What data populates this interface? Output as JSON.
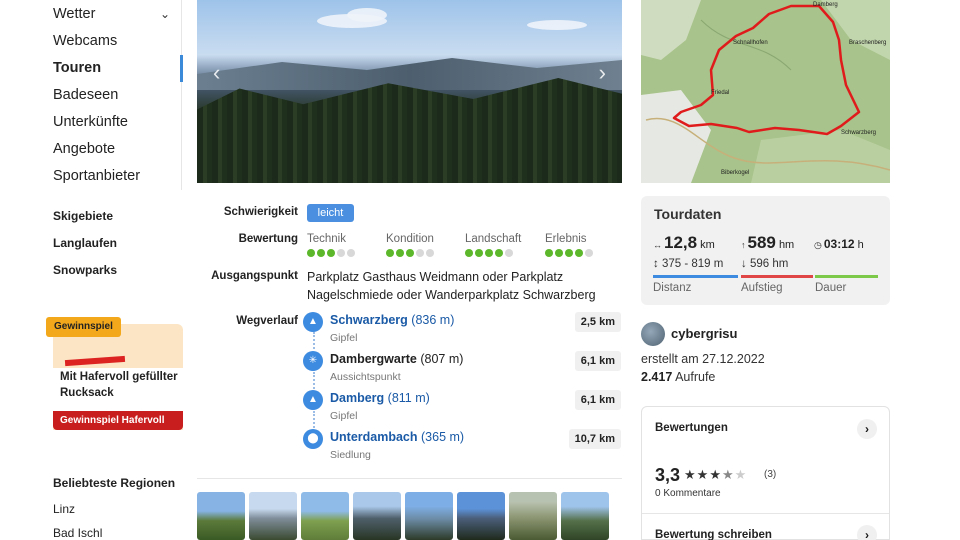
{
  "sidebar": {
    "main_items": [
      {
        "label": "Wetter"
      },
      {
        "label": "Webcams"
      },
      {
        "label": "Touren"
      },
      {
        "label": "Badeseen"
      },
      {
        "label": "Unterkünfte"
      },
      {
        "label": "Angebote"
      },
      {
        "label": "Sportanbieter"
      }
    ],
    "active_item": "Touren",
    "sub_items": [
      {
        "label": "Skigebiete"
      },
      {
        "label": "Langlaufen"
      },
      {
        "label": "Snowparks"
      }
    ],
    "promo": {
      "tag": "Gewinnspiel",
      "title": "Mit Hafervoll gefüllter Rucksack",
      "button": "Gewinnspiel Hafervoll"
    },
    "regions": {
      "heading": "Beliebteste Regionen",
      "links": [
        "Linz",
        "Bad Ischl"
      ]
    }
  },
  "details": {
    "difficulty_label": "Schwierigkeit",
    "difficulty_value": "leicht",
    "rating_label": "Bewertung",
    "ratings": [
      {
        "label": "Technik",
        "score": 3,
        "max": 5
      },
      {
        "label": "Kondition",
        "score": 3,
        "max": 5
      },
      {
        "label": "Landschaft",
        "score": 4,
        "max": 5
      },
      {
        "label": "Erlebnis",
        "score": 4,
        "max": 5
      }
    ],
    "start_label": "Ausgangspunkt",
    "start_value": "Parkplatz Gasthaus Weidmann oder Parkplatz Nagelschmiede oder Wanderparkplatz Schwarzberg",
    "route_label": "Wegverlauf",
    "stops": [
      {
        "name": "Schwarzberg",
        "elevation": "(836 m)",
        "type": "Gipfel",
        "km": "2,5 km",
        "icon": "peak-icon",
        "link": true
      },
      {
        "name": "Dambergwarte",
        "elevation": "(807 m)",
        "type": "Aussichtspunkt",
        "km": "6,1 km",
        "icon": "viewpoint-icon",
        "link": false
      },
      {
        "name": "Damberg",
        "elevation": "(811 m)",
        "type": "Gipfel",
        "km": "6,1 km",
        "icon": "peak-icon",
        "link": true
      },
      {
        "name": "Unterdambach",
        "elevation": "(365 m)",
        "type": "Siedlung",
        "km": "10,7 km",
        "icon": "location-pin-icon",
        "link": true
      }
    ]
  },
  "map": {
    "labels": [
      "Damberg",
      "Braschenberg",
      "Schwarzberg",
      "Biberkogel",
      "Schnallhofen",
      "Friedal"
    ],
    "route_color": "#e01b1b"
  },
  "tourdaten": {
    "heading": "Tourdaten",
    "distance_value": "12,8",
    "distance_unit": "km",
    "ascent_value": "589",
    "ascent_unit": "hm",
    "duration_value": "03:12",
    "duration_unit": "h",
    "altitude_range": "375 - 819",
    "altitude_unit": "m",
    "descent": "596",
    "descent_unit": "hm",
    "caption_distance": "Distanz",
    "caption_ascent": "Aufstieg",
    "caption_duration": "Dauer",
    "colors": {
      "distance": "#3d8be0",
      "ascent": "#e04646",
      "duration": "#7cc94a"
    }
  },
  "author": {
    "name": "cybergrisu",
    "created": "erstellt am 27.12.2022",
    "views_count": "2.417",
    "views_label": "Aufrufe"
  },
  "ratings_box": {
    "title": "Bewertungen",
    "score": "3,3",
    "stars_filled": 3.5,
    "stars_max": 5,
    "count": "(3)",
    "comments": "0 Kommentare",
    "write": "Bewertung schreiben"
  },
  "accent_color": "#3d8be0"
}
